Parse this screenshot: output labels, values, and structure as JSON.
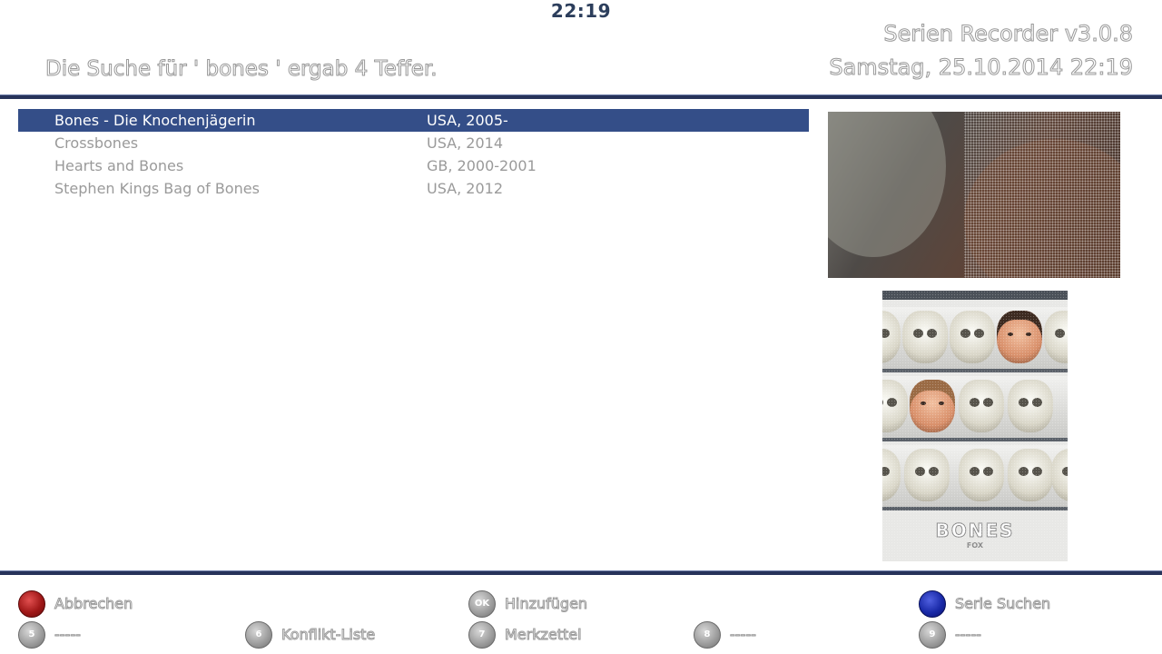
{
  "header": {
    "clock": "22:19",
    "app_title": "Serien Recorder v3.0.8",
    "datetime": "Samstag, 25.10.2014  22:19",
    "search_result": "Die Suche für ' bones ' ergab 4 Teffer."
  },
  "results": [
    {
      "title": "Bones - Die Knochenjägerin",
      "info": "USA, 2005-",
      "selected": true
    },
    {
      "title": "Crossbones",
      "info": "USA, 2014",
      "selected": false
    },
    {
      "title": "Hearts and Bones",
      "info": "GB, 2000-2001",
      "selected": false
    },
    {
      "title": "Stephen Kings Bag of Bones",
      "info": "USA, 2012",
      "selected": false
    }
  ],
  "cover": {
    "logo": "BONES",
    "sub": "FOX"
  },
  "footer": {
    "red": {
      "label": "Abbrechen",
      "color": "#a01818"
    },
    "ok": {
      "key": "OK",
      "label": "Hinzufügen"
    },
    "blue": {
      "label": "Serie Suchen",
      "color": "#1a2aa8"
    },
    "key5": {
      "key": "5",
      "label": "-----"
    },
    "key6": {
      "key": "6",
      "label": "Konflikt-Liste"
    },
    "key7": {
      "key": "7",
      "label": "Merkzettel"
    },
    "key8": {
      "key": "8",
      "label": "-----"
    },
    "key9": {
      "key": "9",
      "label": "-----"
    }
  },
  "colors": {
    "accent": "#344e88",
    "rule": "#27335a"
  }
}
